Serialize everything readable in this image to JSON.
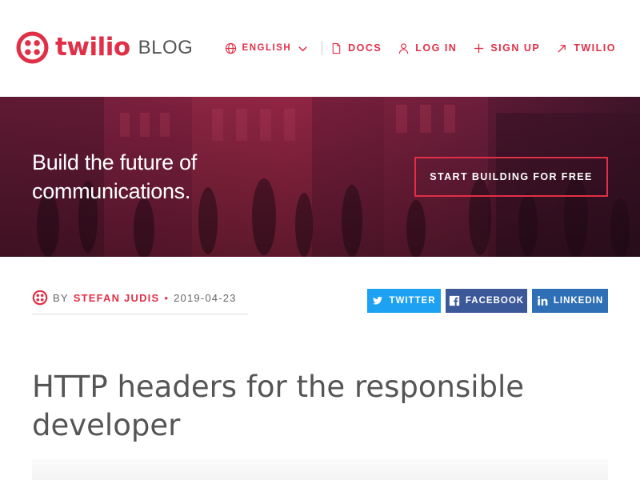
{
  "brand": {
    "name": "twilio",
    "section": "BLOG",
    "accent": "#e02f46"
  },
  "nav": {
    "language": "ENGLISH",
    "items": [
      {
        "label": "DOCS",
        "icon": "document-icon"
      },
      {
        "label": "LOG IN",
        "icon": "user-icon"
      },
      {
        "label": "SIGN UP",
        "icon": "plus-icon"
      },
      {
        "label": "TWILIO",
        "icon": "external-arrow-icon"
      }
    ]
  },
  "hero": {
    "headline_line1": "Build the future of",
    "headline_line2": "communications.",
    "cta": "START BUILDING FOR FREE"
  },
  "post": {
    "by": "BY",
    "author": "STEFAN JUDIS",
    "separator": "•",
    "date": "2019-04-23",
    "title": "HTTP headers for the responsible developer"
  },
  "share": {
    "twitter": "TWITTER",
    "facebook": "FACEBOOK",
    "linkedin": "LINKEDIN"
  },
  "colors": {
    "twitter": "#1da1f2",
    "facebook": "#3b5998",
    "linkedin": "#2f6fb5"
  }
}
